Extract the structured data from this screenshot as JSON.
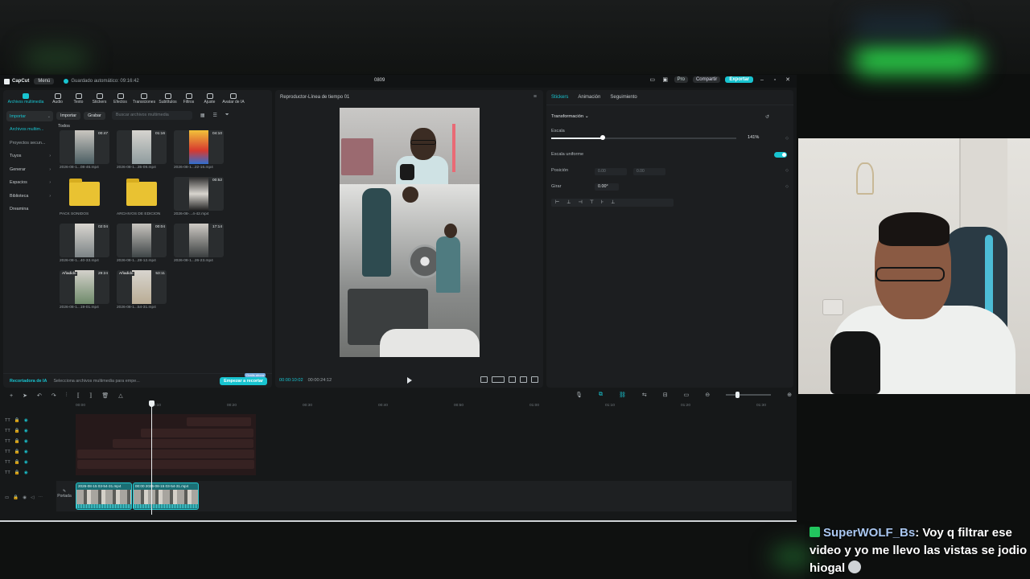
{
  "app": {
    "brand": "CapCut",
    "menu_label": "Menú",
    "autosave": "Guardado automático: 09:16:42",
    "project_name": "0809",
    "pro_label": "Pro",
    "share_label": "Compartir",
    "export_label": "Exportar",
    "accent": "#18c4d0"
  },
  "toolbar": {
    "tabs": [
      {
        "label": "Archivos multimedia",
        "icon": "media-icon"
      },
      {
        "label": "Audio",
        "icon": "audio-icon"
      },
      {
        "label": "Texto",
        "icon": "text-icon"
      },
      {
        "label": "Stickers",
        "icon": "sticker-icon"
      },
      {
        "label": "Efectos",
        "icon": "effects-icon"
      },
      {
        "label": "Transiciones",
        "icon": "transitions-icon"
      },
      {
        "label": "Subtítulos",
        "icon": "subtitles-icon"
      },
      {
        "label": "Filtros",
        "icon": "filters-icon"
      },
      {
        "label": "Ajuste",
        "icon": "adjust-icon"
      },
      {
        "label": "Avatar de IA",
        "icon": "avatar-icon"
      }
    ]
  },
  "sidenav": {
    "items": [
      {
        "label": "Importar"
      },
      {
        "label": "Archivos multim..."
      },
      {
        "label": "Proyectos secun..."
      },
      {
        "label": "Tuyos"
      },
      {
        "label": "Generar"
      },
      {
        "label": "Espacios"
      },
      {
        "label": "Biblioteca"
      },
      {
        "label": "Dreamina"
      }
    ]
  },
  "media": {
    "import_label": "Importar",
    "record_label": "Grabar",
    "search_placeholder": "Buscar archivos multimedia",
    "all_label": "Todos",
    "items": [
      {
        "name": "2026-08-1...08-46.mp4",
        "duration": "00:47",
        "added": ""
      },
      {
        "name": "2026-08-1...35-09.mp4",
        "duration": "01:16",
        "added": ""
      },
      {
        "name": "2026-08-1...22-16.mp4",
        "duration": "04:10",
        "added": ""
      },
      {
        "name": "PACK SONIDOS",
        "duration": "",
        "added": ""
      },
      {
        "name": "ARCHIVOS DE EDICION",
        "duration": "",
        "added": ""
      },
      {
        "name": "2026-08-...4-42.mp4",
        "duration": "00:52",
        "added": ""
      },
      {
        "name": "2026-08-1...40-33.mp4",
        "duration": "02:04",
        "added": ""
      },
      {
        "name": "2026-08-1...28-12.mp4",
        "duration": "00:04",
        "added": ""
      },
      {
        "name": "2026-08-1...26-23.mp4",
        "duration": "17:14",
        "added": ""
      },
      {
        "name": "2026-08-1...19-01.mp4",
        "duration": "29:24",
        "added": "Añadido"
      },
      {
        "name": "2026-08-1...54-31.mp4",
        "duration": "53:11",
        "added": "Añadido"
      }
    ],
    "footer_ai": "Recortadora de IA",
    "footer_hint": "Selecciona archivos multimedia para empe...",
    "footer_cta": "Empezar a recortar",
    "footer_badge": "Gratis ahora"
  },
  "player": {
    "title": "Reproductor-Línea de tiempo 01",
    "time_current": "00:00:10:02",
    "time_total": "00:00:24:12"
  },
  "props": {
    "tabs": [
      "Stickers",
      "Animación",
      "Seguimiento"
    ],
    "section": "Transformación",
    "scale_label": "Escala",
    "scale_value": "141%",
    "scale_fraction": 0.28,
    "uniform_label": "Escala uniforme",
    "position_label": "Posición",
    "pos_x": "0.00",
    "pos_y": "0.00",
    "rotate_label": "Girar",
    "rotate_value": "0.00°"
  },
  "timeline": {
    "ruler": [
      "00:00",
      "00:10",
      "00:20",
      "00:30",
      "00:40",
      "00:50",
      "01:00",
      "01:10",
      "01:20",
      "01:30"
    ],
    "cover_label": "Portada",
    "clips": [
      {
        "title": "2026-08-15 03-54-31.mp4",
        "duration": "00:00"
      },
      {
        "title": "2026-08-15 03-54-31.mp4",
        "duration": ""
      }
    ]
  },
  "chat": {
    "username": "SuperWOLF_Bs",
    "message": "Voy q filtrar ese video y yo me llevo las vistas se jodio hiogal"
  }
}
